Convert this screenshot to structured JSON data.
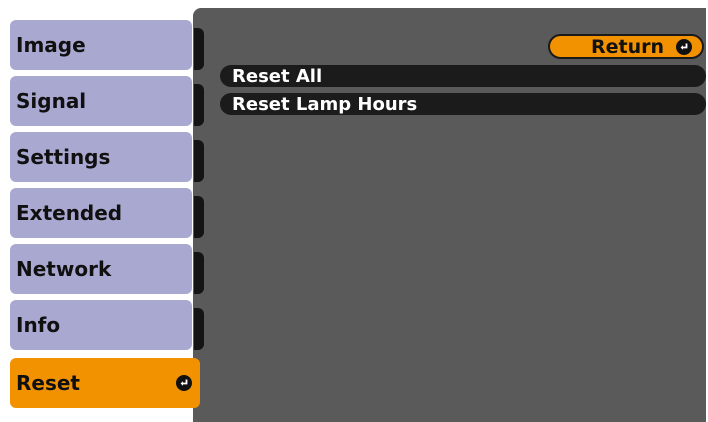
{
  "sidebar": {
    "items": [
      {
        "label": "Image"
      },
      {
        "label": "Signal"
      },
      {
        "label": "Settings"
      },
      {
        "label": "Extended"
      },
      {
        "label": "Network"
      },
      {
        "label": "Info"
      },
      {
        "label": "Reset",
        "active": true
      }
    ]
  },
  "main": {
    "return_label": "Return",
    "items": [
      {
        "label": "Reset All"
      },
      {
        "label": "Reset Lamp Hours"
      }
    ]
  },
  "colors": {
    "accent": "#f39200",
    "tab_inactive": "#a8a8d0",
    "panel_bg": "#5a5a5a",
    "item_bg": "#1b1b1b"
  },
  "icons": {
    "enter": "enter-icon"
  }
}
